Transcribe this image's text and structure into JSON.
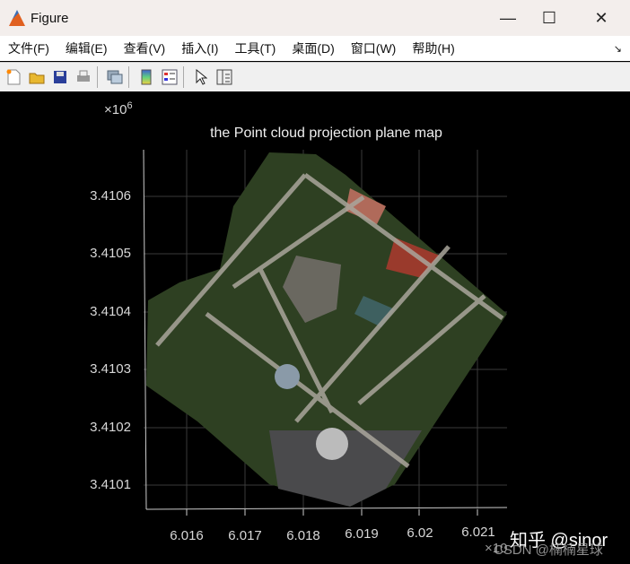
{
  "window": {
    "title": "Figure",
    "minimize": "—",
    "maximize": "☐",
    "close": "✕"
  },
  "menu": [
    "文件(F)",
    "编辑(E)",
    "查看(V)",
    "插入(I)",
    "工具(T)",
    "桌面(D)",
    "窗口(W)",
    "帮助(H)"
  ],
  "menu_dock": "↘",
  "toolbar": [
    "new-figure",
    "open-file",
    "save",
    "print",
    "link-plot",
    "insert-colorbar",
    "insert-legend",
    "edit-plot",
    "property-inspector"
  ],
  "plot": {
    "title": "the Point cloud projection plane map",
    "y_exponent": "×10",
    "y_exponent_power": "6",
    "x_exponent": "×10",
    "y_ticks": [
      "3.4106",
      "3.4105",
      "3.4104",
      "3.4103",
      "3.4102",
      "3.4101"
    ],
    "x_ticks": [
      "6.016",
      "6.017",
      "6.018",
      "6.019",
      "6.02",
      "6.021"
    ]
  },
  "watermark": {
    "zhihu": "知乎 @sinor",
    "csdn": "CSDN @楠楠星球"
  }
}
